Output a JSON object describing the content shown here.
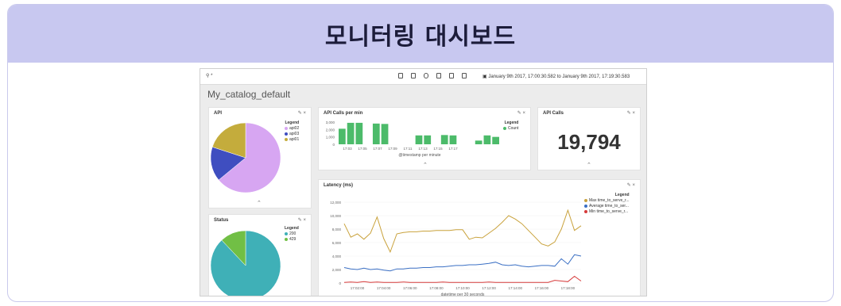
{
  "page": {
    "title": "모니터링 대시보드"
  },
  "toolbar": {
    "search_value": "*",
    "time_range": "January 9th 2017, 17:00:30.582 to January 9th 2017, 17:19:30.583",
    "icons": [
      "new-icon",
      "save-icon",
      "open-icon",
      "share-icon",
      "reporting-icon",
      "print-icon"
    ]
  },
  "dashboard": {
    "name": "My_catalog_default"
  },
  "panels": {
    "api": {
      "title": "API",
      "legend_title": "Legend",
      "legend": [
        {
          "label": "api02",
          "color": "#d7a6f2"
        },
        {
          "label": "api03",
          "color": "#3f4ec0"
        },
        {
          "label": "api01",
          "color": "#c4ac3c"
        }
      ]
    },
    "calls": {
      "title": "API Calls per min",
      "legend_title": "Legend",
      "legend": [
        {
          "label": "Count",
          "color": "#4cbb6a"
        }
      ],
      "xlabel": "@timestamp per minute"
    },
    "total": {
      "title": "API Calls",
      "value": "19,794"
    },
    "status": {
      "title": "Status",
      "legend_title": "Legend",
      "legend": [
        {
          "label": "200",
          "color": "#3fb0b7"
        },
        {
          "label": "429",
          "color": "#71bf45"
        }
      ]
    },
    "latency": {
      "title": "Latency (ms)",
      "legend_title": "Legend",
      "legend": [
        {
          "label": "Max time_to_serve_r...",
          "color": "#c9a23c"
        },
        {
          "label": "Average time_to_ser...",
          "color": "#3a6fc4"
        },
        {
          "label": "Min time_to_serve_r...",
          "color": "#d63a3a"
        }
      ],
      "xlabel": "datetime per 30 seconds"
    }
  },
  "chart_data": [
    {
      "type": "pie",
      "title": "API",
      "labels": [
        "api02",
        "api03",
        "api01"
      ],
      "values": [
        64,
        16,
        20
      ],
      "colors": [
        "#d7a6f2",
        "#3f4ec0",
        "#c4ac3c"
      ]
    },
    {
      "type": "bar",
      "title": "API Calls per min",
      "xlabel": "@timestamp per minute",
      "ylim": [
        0,
        3000
      ],
      "yticks": [
        "3,000",
        "2,000",
        "1,000",
        "0"
      ],
      "xticks": [
        "17:03",
        "17:05",
        "17:07",
        "17:09",
        "17:11",
        "17:13",
        "17:15",
        "17:17"
      ],
      "series": [
        {
          "name": "Count",
          "color": "#4cbb6a",
          "values": [
            2100,
            2900,
            2900,
            0,
            2800,
            2750,
            0,
            0,
            0,
            1200,
            1200,
            0,
            1250,
            1200,
            0,
            0,
            500,
            1200,
            1000
          ]
        }
      ]
    },
    {
      "type": "pie",
      "title": "Status",
      "labels": [
        "200",
        "429"
      ],
      "values": [
        88,
        12
      ],
      "colors": [
        "#3fb0b7",
        "#71bf45"
      ]
    },
    {
      "type": "line",
      "title": "Latency (ms)",
      "xlabel": "datetime per 30 seconds",
      "ylim": [
        0,
        12000
      ],
      "yticks": [
        "12,000",
        "10,000",
        "8,000",
        "6,000",
        "4,000",
        "2,000",
        "0"
      ],
      "xticks": [
        "17:02:00",
        "17:04:00",
        "17:06:00",
        "17:08:00",
        "17:10:00",
        "17:12:00",
        "17:14:00",
        "17:16:00",
        "17:18:00"
      ],
      "x": [
        0,
        0.5,
        1,
        1.5,
        2,
        2.5,
        3,
        3.5,
        4,
        4.5,
        5,
        5.5,
        6,
        6.5,
        7,
        7.5,
        8,
        8.5,
        9,
        9.5,
        10,
        10.5,
        11,
        11.5,
        12,
        12.5,
        13,
        13.5,
        14,
        14.5,
        15,
        15.5,
        16,
        16.5,
        17,
        17.5,
        18
      ],
      "series": [
        {
          "name": "Max time_to_serve_r...",
          "color": "#c9a23c",
          "values": [
            8800,
            6800,
            7300,
            6500,
            7400,
            9800,
            6600,
            4600,
            7300,
            7500,
            7600,
            7600,
            7700,
            7700,
            7800,
            7800,
            7800,
            7900,
            7900,
            6500,
            6800,
            6700,
            7400,
            8100,
            9000,
            10000,
            9500,
            8800,
            7800,
            6800,
            5800,
            5500,
            6100,
            8000,
            10800,
            7800,
            8500
          ]
        },
        {
          "name": "Average time_to_ser...",
          "color": "#3a6fc4",
          "values": [
            2300,
            2100,
            2000,
            2200,
            2000,
            2100,
            1900,
            1800,
            2100,
            2100,
            2200,
            2200,
            2300,
            2300,
            2400,
            2400,
            2500,
            2600,
            2600,
            2700,
            2700,
            2800,
            2900,
            3100,
            2700,
            2600,
            2700,
            2500,
            2400,
            2500,
            2600,
            2600,
            2500,
            3600,
            2800,
            4200,
            4000
          ]
        },
        {
          "name": "Min time_to_serve_r...",
          "color": "#d63a3a",
          "values": [
            100,
            150,
            100,
            200,
            100,
            150,
            100,
            100,
            100,
            150,
            100,
            100,
            100,
            100,
            100,
            150,
            100,
            100,
            100,
            100,
            100,
            100,
            150,
            100,
            100,
            100,
            100,
            100,
            100,
            100,
            100,
            100,
            400,
            300,
            200,
            1000,
            300
          ]
        }
      ]
    }
  ]
}
